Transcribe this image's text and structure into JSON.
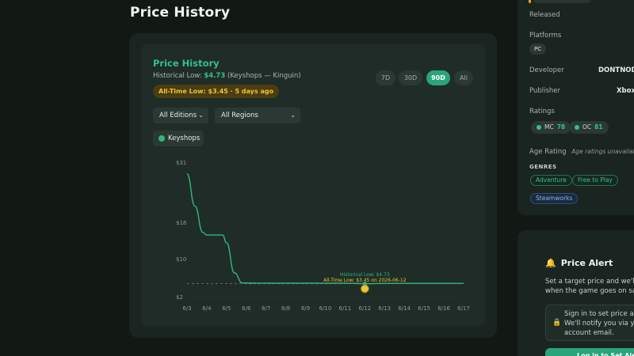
{
  "page": {
    "title": "Price History"
  },
  "price_history": {
    "title": "Price History",
    "historical_low_label": "Historical Low:",
    "historical_low_value": "$4.73",
    "historical_low_source": "(Keyshops — Kinguin)",
    "all_time_low_badge": "All-Time Low: $3.45 · 5 days ago",
    "ranges": [
      {
        "label": "7D",
        "active": false
      },
      {
        "label": "30D",
        "active": false
      },
      {
        "label": "90D",
        "active": true
      },
      {
        "label": "All",
        "active": false
      }
    ],
    "editions_select": "All Editions",
    "regions_select": "All Regions",
    "legend": {
      "label": "Keyshops",
      "color": "#2fb87a"
    }
  },
  "chart_data": {
    "type": "line",
    "x": [
      "6/3",
      "6/4",
      "6/5",
      "6/6",
      "6/7",
      "6/8",
      "6/9",
      "6/10",
      "6/11",
      "6/12",
      "6/13",
      "6/14",
      "6/15",
      "6/16",
      "6/17"
    ],
    "y_ticks": [
      "$31",
      "$18",
      "$10",
      "$2"
    ],
    "series": [
      {
        "color": "#2fb87a",
        "points": [
          [
            0,
            28.5
          ],
          [
            0.4,
            21.5
          ],
          [
            0.8,
            15.8
          ],
          [
            1.0,
            15.2
          ],
          [
            1.8,
            15.2
          ],
          [
            2.0,
            13.5
          ],
          [
            2.4,
            7.0
          ],
          [
            2.8,
            4.9
          ],
          [
            3.5,
            4.85
          ],
          [
            4,
            4.85
          ],
          [
            5,
            4.85
          ],
          [
            6,
            4.85
          ],
          [
            7,
            4.85
          ],
          [
            8,
            4.85
          ],
          [
            9,
            4.73
          ],
          [
            10,
            4.8
          ],
          [
            11,
            4.8
          ],
          [
            12,
            4.8
          ],
          [
            13,
            4.8
          ],
          [
            14,
            4.8
          ]
        ]
      }
    ],
    "reference_line": {
      "value": 4.73,
      "color": "#6b7d73",
      "dashed": true
    },
    "annotations": [
      {
        "text": "Historical Low: $4.73",
        "color": "#2fb87a",
        "x": 9,
        "y": 4.73
      },
      {
        "text": "All-Time Low: $3.45 on 2026-06-12",
        "color": "#f1c232",
        "x": 9,
        "y": 3.45
      }
    ],
    "ylim": [
      2,
      31
    ],
    "grid": true
  },
  "sidebar": {
    "released_label": "Released",
    "platforms_label": "Platforms",
    "platform_chip": "PC",
    "developer_label": "Developer",
    "developer_value": "DONTNOD E",
    "publisher_label": "Publisher",
    "publisher_value": "Xbox",
    "ratings_label": "Ratings",
    "ratings": [
      {
        "source": "MC",
        "score": "78",
        "color": "#34c08a"
      },
      {
        "source": "OC",
        "score": "81",
        "color": "#34c08a"
      }
    ],
    "age_rating_label": "Age Rating",
    "age_rating_value": "Age ratings unavailable",
    "genres_label": "GENRES",
    "genres": [
      "Adventure",
      "Free to Play"
    ],
    "tags": [
      "Steamworks"
    ]
  },
  "price_alert": {
    "title": "Price Alert",
    "description_line1": "Set a target price and we'll e",
    "description_line2": "when the game goes on sale",
    "signin_line1": "Sign in to set price ale",
    "signin_line2": "We'll notify you via you",
    "signin_line3": "account email.",
    "button_label": "Log in to Set Alert"
  }
}
